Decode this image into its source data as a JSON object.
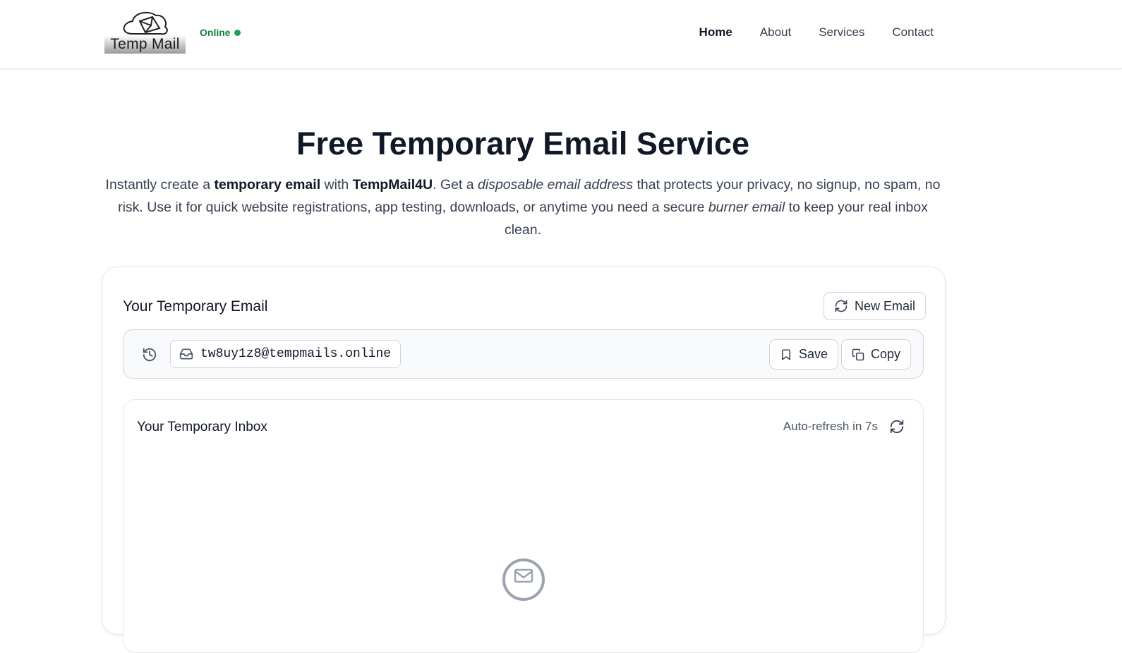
{
  "header": {
    "logo_text": "Temp Mail",
    "status": "Online",
    "nav": [
      "Home",
      "About",
      "Services",
      "Contact"
    ]
  },
  "hero": {
    "title": "Free Temporary Email Service",
    "desc": [
      {
        "t": "Instantly create a ",
        "s": "n"
      },
      {
        "t": "temporary email",
        "s": "b"
      },
      {
        "t": " with ",
        "s": "n"
      },
      {
        "t": "TempMail4U",
        "s": "b"
      },
      {
        "t": ". Get a ",
        "s": "n"
      },
      {
        "t": "disposable email address",
        "s": "i"
      },
      {
        "t": " that protects your privacy, no signup, no spam, no risk. Use it for quick website registrations, app testing, downloads, or anytime you need a secure ",
        "s": "n"
      },
      {
        "t": "burner email",
        "s": "i"
      },
      {
        "t": " to keep your real inbox clean.",
        "s": "n"
      }
    ]
  },
  "email_card": {
    "title": "Your Temporary Email",
    "new_email_label": "New Email",
    "address": "tw8uy1z8@tempmails.online",
    "save_label": "Save",
    "copy_label": "Copy"
  },
  "inbox": {
    "title": "Your Temporary Inbox",
    "auto_refresh": "Auto-refresh in 7s"
  },
  "colors": {
    "status_green": "#15803d",
    "status_dot": "#22a05a",
    "heading": "#111827"
  },
  "icons": [
    "envelope-logo-icon",
    "status-dot",
    "refresh-icon",
    "history-icon",
    "inbox-icon",
    "bookmark-icon",
    "copy-icon",
    "mail-circle-icon"
  ]
}
